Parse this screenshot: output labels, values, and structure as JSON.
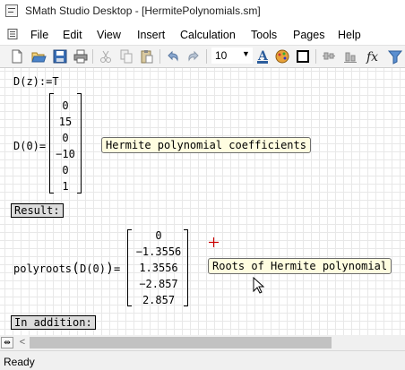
{
  "window": {
    "title": "SMath Studio Desktop - [HermitePolynomials.sm]"
  },
  "menu": {
    "items": [
      "File",
      "Edit",
      "View",
      "Insert",
      "Calculation",
      "Tools",
      "Pages",
      "Help"
    ]
  },
  "toolbar": {
    "buttons": [
      "new-document-icon",
      "open-icon",
      "save-icon",
      "print-icon",
      "cut-icon",
      "copy-icon",
      "paste-icon",
      "undo-icon",
      "redo-icon",
      "font-size-select",
      "text-color-icon",
      "fill-color-icon",
      "border-icon",
      "align-icon",
      "align-bottom-icon",
      "function-icon",
      "filter-icon"
    ],
    "font_size": "10"
  },
  "worksheet": {
    "def_lhs": "D(z)",
    "def_op": ":=",
    "def_rhs": "T",
    "eval1_lhs": "D(0)=",
    "coefficients": [
      "0",
      "15",
      "0",
      "−10",
      "0",
      "1"
    ],
    "annotation_coefficients": "Hermite polynomial coefficients",
    "result_label": "Result:",
    "eval2_lhs": "polyroots",
    "eval2_arg": "D(0)",
    "eval2_eq": "=",
    "roots": [
      "0",
      "−1.3556",
      "1.3556",
      "−2.857",
      "2.857"
    ],
    "annotation_roots": "Roots of Hermite polynomial",
    "in_addition_label": "In addition:"
  },
  "status": {
    "text": "Ready"
  },
  "colors": {
    "annotation_bg": "#fffde0",
    "section_label_bg": "#dcdcdc",
    "grid": "#e8e8e8",
    "cursor": "#cc0000",
    "toolbar_bg": "#f3f3f3"
  }
}
